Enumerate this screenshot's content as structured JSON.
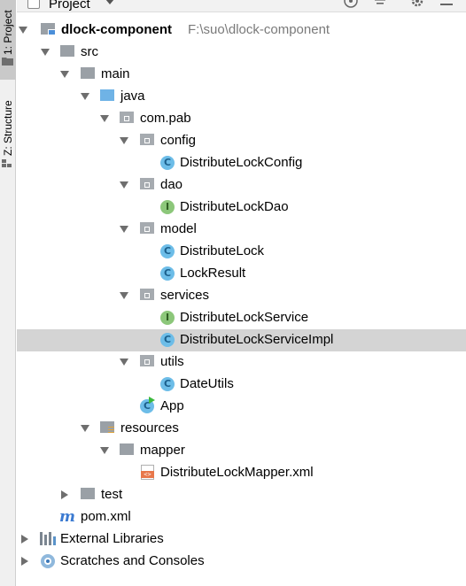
{
  "toolstrip": {
    "project_tab": "1: Project",
    "structure_tab": "Z: Structure"
  },
  "header": {
    "title": "Project"
  },
  "tree": {
    "root": {
      "label": "dlock-component",
      "path": "F:\\suo\\dlock-component"
    },
    "src": "src",
    "main": "main",
    "java": "java",
    "package": "com.pab",
    "config": "config",
    "config_class": "DistributeLockConfig",
    "dao": "dao",
    "dao_interface": "DistributeLockDao",
    "model": "model",
    "model_class_1": "DistributeLock",
    "model_class_2": "LockResult",
    "services": "services",
    "service_interface": "DistributeLockService",
    "service_impl": "DistributeLockServiceImpl",
    "utils": "utils",
    "utils_class": "DateUtils",
    "app": "App",
    "resources": "resources",
    "mapper": "mapper",
    "mapper_xml": "DistributeLockMapper.xml",
    "test": "test",
    "pom": "pom.xml",
    "external_libraries": "External Libraries",
    "scratches": "Scratches and Consoles"
  },
  "icons": {
    "class_letter": "C",
    "interface_letter": "I",
    "xml_tag": "<>",
    "maven_letter": "m"
  },
  "colors": {
    "selected_row": "#d4d4d4",
    "folder_blue": "#6fb3e6",
    "class_badge": "#6dbde8",
    "interface_badge": "#8cc77a"
  }
}
